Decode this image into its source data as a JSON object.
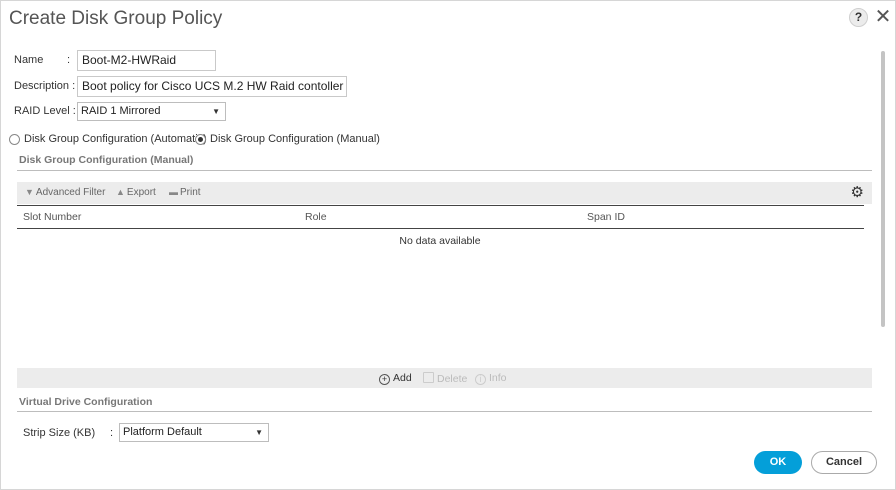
{
  "window": {
    "title": "Create Disk Group Policy",
    "help_label": "?",
    "close_label": "✕"
  },
  "form": {
    "name_label": "Name",
    "name_value": "Boot-M2-HWRaid",
    "description_label": "Description :",
    "description_value": "Boot policy for Cisco UCS M.2 HW Raid contoller",
    "raid_level_label": "RAID Level :",
    "raid_level_value": "RAID 1 Mirrored"
  },
  "config_mode": {
    "automatic_label": "Disk Group Configuration (Automatic)",
    "manual_label": "Disk Group Configuration (Manual)",
    "selected": "manual"
  },
  "disk_group_section": {
    "title": "Disk Group Configuration (Manual)",
    "toolbar": {
      "advanced_filter": "Advanced Filter",
      "export": "Export",
      "print": "Print"
    },
    "table": {
      "columns": [
        "Slot Number",
        "Role",
        "Span ID"
      ],
      "rows": [],
      "empty_text": "No data available"
    },
    "actions": {
      "add": "Add",
      "delete": "Delete",
      "info": "Info"
    }
  },
  "virtual_drive_section": {
    "title": "Virtual Drive Configuration",
    "strip_size_label": "Strip Size (KB)",
    "strip_size_value": "Platform Default"
  },
  "buttons": {
    "ok": "OK",
    "cancel": "Cancel"
  },
  "colors": {
    "primary_button": "#049fd9",
    "toolbar_bg": "#ececec"
  }
}
